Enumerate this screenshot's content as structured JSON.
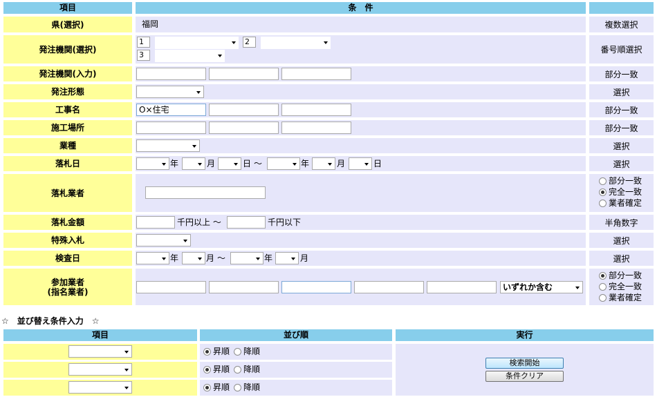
{
  "header": {
    "item": "項目",
    "condition": "条　件"
  },
  "rows": {
    "prefecture": {
      "label": "県(選択)",
      "value": "福岡",
      "note": "複数選択"
    },
    "agency_select": {
      "label": "発注機関(選択)",
      "num1": "1",
      "num2": "2",
      "num3": "3",
      "note": "番号順選択"
    },
    "agency_input": {
      "label": "発注機関(入力)",
      "note": "部分一致"
    },
    "order_type": {
      "label": "発注形態",
      "note": "選択"
    },
    "work_name": {
      "label": "工事名",
      "value1": "O×住宅",
      "note": "部分一致"
    },
    "work_place": {
      "label": "施工場所",
      "note": "部分一致"
    },
    "industry": {
      "label": "業種",
      "note": "選択"
    },
    "bid_date": {
      "label": "落札日",
      "year": "年",
      "month": "月",
      "day": "日",
      "tilde": "～",
      "note": "選択"
    },
    "winner": {
      "label": "落札業者",
      "options": [
        "部分一致",
        "完全一致",
        "業者確定"
      ],
      "selected": 1
    },
    "amount": {
      "label": "落札金額",
      "unit_from": "千円以上 ～",
      "unit_to": "千円以下",
      "note": "半角数字"
    },
    "special_bid": {
      "label": "特殊入札",
      "note": "選択"
    },
    "inspection": {
      "label": "検査日",
      "year": "年",
      "month": "月",
      "tilde": "～",
      "note": "選択"
    },
    "participants": {
      "label1": "参加業者",
      "label2": "(指名業者)",
      "select_value": "いずれか含む",
      "options": [
        "部分一致",
        "完全一致",
        "業者確定"
      ],
      "selected": 0
    }
  },
  "sort": {
    "title": "☆　並び替え条件入力　☆",
    "header_item": "項目",
    "header_order": "並び順",
    "header_exec": "実行",
    "asc": "昇順",
    "desc": "降順",
    "search_button": "検索開始",
    "clear_button": "条件クリア"
  },
  "colors": {
    "header": "#87CEEB",
    "label": "#FFFF99",
    "cell": "#E6E6FA"
  }
}
